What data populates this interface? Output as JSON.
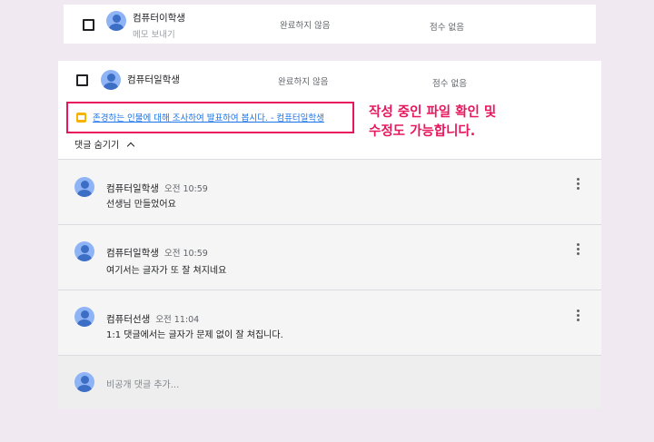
{
  "students": [
    {
      "name": "컴퓨터이학생",
      "sub": "메모 보내기",
      "status": "완료하지 않음",
      "score": "점수 없음"
    },
    {
      "name": "컴퓨터일학생",
      "status": "완료하지 않음",
      "score": "점수 없음"
    }
  ],
  "attachment": {
    "title": "존경하는 인물에 대해 조사하여 발표하여 봅시다. - 컴퓨터일학생",
    "icon": "slides-icon",
    "color": "#f6b400"
  },
  "annotation": {
    "line1": "작성 중인 파일 확인 및",
    "line2": "수정도 가능합니다.",
    "color": "#e8175d"
  },
  "comments_toggle": "댓글 숨기기",
  "comments": [
    {
      "author": "컴퓨터일학생",
      "time": "오전 10:59",
      "text": "선생님 만들었어요"
    },
    {
      "author": "컴퓨터일학생",
      "time": "오전 10:59",
      "text": "여기서는 글자가 또 잘 쳐지네요"
    },
    {
      "author": "컴퓨터선생",
      "time": "오전 11:04",
      "text": "1:1 댓글에서는 글자가 문제 없이 잘 쳐집니다."
    }
  ],
  "reply_placeholder": "비공개 댓글 추가..."
}
